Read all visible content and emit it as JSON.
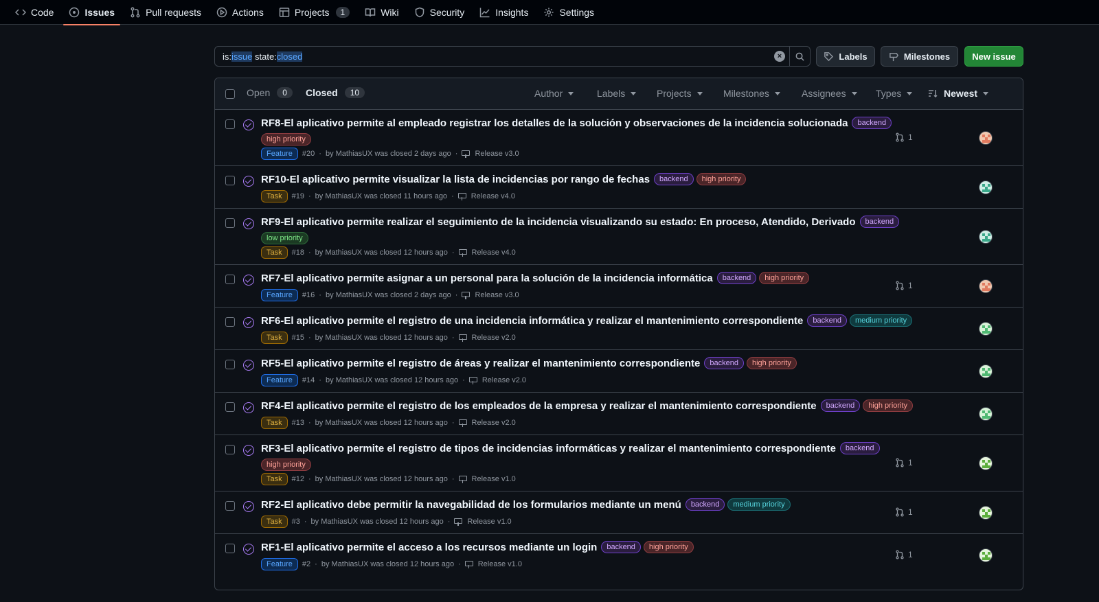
{
  "nav": {
    "items": [
      {
        "label": "Code",
        "icon": "code-icon"
      },
      {
        "label": "Issues",
        "icon": "issue-opened-icon",
        "active": true
      },
      {
        "label": "Pull requests",
        "icon": "git-pull-request-icon"
      },
      {
        "label": "Actions",
        "icon": "play-icon"
      },
      {
        "label": "Projects",
        "icon": "table-icon",
        "counter": "1"
      },
      {
        "label": "Wiki",
        "icon": "book-icon"
      },
      {
        "label": "Security",
        "icon": "shield-icon"
      },
      {
        "label": "Insights",
        "icon": "graph-icon"
      },
      {
        "label": "Settings",
        "icon": "gear-icon"
      }
    ]
  },
  "search": {
    "tokens": [
      {
        "key": "is:",
        "value": "issue"
      },
      {
        "key": "state:",
        "value": "closed"
      }
    ]
  },
  "toolbar": {
    "labels_label": "Labels",
    "milestones_label": "Milestones",
    "new_issue_label": "New issue"
  },
  "header": {
    "open_label": "Open",
    "open_count": "0",
    "closed_label": "Closed",
    "closed_count": "10",
    "filters": [
      "Author",
      "Labels",
      "Projects",
      "Milestones",
      "Assignees",
      "Types"
    ],
    "sort_label": "Newest"
  },
  "colors": {
    "closed_state": "#ab7df8",
    "accent_underline": "#f78166",
    "new_issue_green": "#238636"
  },
  "issues": [
    {
      "title": "RF8-El aplicativo permite al empleado registrar los detalles de la solución y observaciones de la incidencia solucionada",
      "labels": [
        {
          "text": "backend",
          "kind": "backend"
        }
      ],
      "extra_labels": [
        {
          "text": "high priority",
          "kind": "high"
        }
      ],
      "type": "Feature",
      "number": "#20",
      "meta": "by MathiasUX was closed 2 days ago",
      "milestone": "Release v3.0",
      "pr_count": "1",
      "avatar": "peach"
    },
    {
      "title": "RF10-El aplicativo permite visualizar la lista de incidencias por rango de fechas",
      "labels": [
        {
          "text": "backend",
          "kind": "backend"
        },
        {
          "text": "high priority",
          "kind": "high"
        }
      ],
      "extra_labels": [],
      "type": "Task",
      "number": "#19",
      "meta": "by MathiasUX was closed 11 hours ago",
      "milestone": "Release v4.0",
      "pr_count": "",
      "avatar": "teal"
    },
    {
      "title": "RF9-El aplicativo permite realizar el seguimiento de la incidencia visualizando su estado: En proceso, Atendido, Derivado",
      "labels": [
        {
          "text": "backend",
          "kind": "backend"
        }
      ],
      "extra_labels": [
        {
          "text": "low priority",
          "kind": "low"
        }
      ],
      "type": "Task",
      "number": "#18",
      "meta": "by MathiasUX was closed 12 hours ago",
      "milestone": "Release v4.0",
      "pr_count": "",
      "avatar": "teal"
    },
    {
      "title": "RF7-El aplicativo permite asignar a un personal para la solución de la incidencia informática",
      "labels": [
        {
          "text": "backend",
          "kind": "backend"
        },
        {
          "text": "high priority",
          "kind": "high"
        }
      ],
      "extra_labels": [],
      "type": "Feature",
      "number": "#16",
      "meta": "by MathiasUX was closed 2 days ago",
      "milestone": "Release v3.0",
      "pr_count": "1",
      "avatar": "peach"
    },
    {
      "title": "RF6-El aplicativo permite el registro de una incidencia informática y realizar el mantenimiento correspondiente",
      "labels": [
        {
          "text": "backend",
          "kind": "backend"
        },
        {
          "text": "medium priority",
          "kind": "medium"
        }
      ],
      "extra_labels": [],
      "type": "Task",
      "number": "#15",
      "meta": "by MathiasUX was closed 12 hours ago",
      "milestone": "Release v2.0",
      "pr_count": "",
      "avatar": "mint"
    },
    {
      "title": "RF5-El aplicativo permite el registro de áreas y realizar el mantenimiento correspondiente",
      "labels": [
        {
          "text": "backend",
          "kind": "backend"
        },
        {
          "text": "high priority",
          "kind": "high"
        }
      ],
      "extra_labels": [],
      "type": "Feature",
      "number": "#14",
      "meta": "by MathiasUX was closed 12 hours ago",
      "milestone": "Release v2.0",
      "pr_count": "",
      "avatar": "mint"
    },
    {
      "title": "RF4-El aplicativo permite el registro de los empleados de la empresa y realizar el mantenimiento correspondiente",
      "labels": [
        {
          "text": "backend",
          "kind": "backend"
        },
        {
          "text": "high priority",
          "kind": "high"
        }
      ],
      "extra_labels": [],
      "type": "Task",
      "number": "#13",
      "meta": "by MathiasUX was closed 12 hours ago",
      "milestone": "Release v2.0",
      "pr_count": "",
      "avatar": "mint"
    },
    {
      "title": "RF3-El aplicativo permite el registro de tipos de incidencias informáticas y realizar el mantenimiento correspondiente",
      "labels": [
        {
          "text": "backend",
          "kind": "backend"
        }
      ],
      "extra_labels": [
        {
          "text": "high priority",
          "kind": "high"
        }
      ],
      "type": "Task",
      "number": "#12",
      "meta": "by MathiasUX was closed 12 hours ago",
      "milestone": "Release v1.0",
      "pr_count": "1",
      "avatar": "green"
    },
    {
      "title": "RF2-El aplicativo debe permitir la navegabilidad de los formularios mediante un menú",
      "labels": [
        {
          "text": "backend",
          "kind": "backend"
        },
        {
          "text": "medium priority",
          "kind": "medium"
        }
      ],
      "extra_labels": [],
      "type": "Task",
      "number": "#3",
      "meta": "by MathiasUX was closed 12 hours ago",
      "milestone": "Release v1.0",
      "pr_count": "1",
      "avatar": "green"
    },
    {
      "title": "RF1-El aplicativo permite el acceso a los recursos mediante un login",
      "labels": [
        {
          "text": "backend",
          "kind": "backend"
        },
        {
          "text": "high priority",
          "kind": "high"
        }
      ],
      "extra_labels": [],
      "type": "Feature",
      "number": "#2",
      "meta": "by MathiasUX was closed 12 hours ago",
      "milestone": "Release v1.0",
      "pr_count": "1",
      "avatar": "green"
    }
  ]
}
